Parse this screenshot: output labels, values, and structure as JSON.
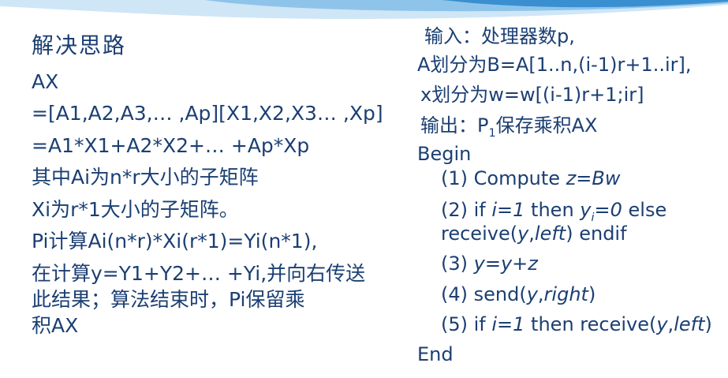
{
  "slide": {
    "left": {
      "title": "解决思路",
      "lines": [
        "AX",
        "=[A1,A2,A3,… ,Ap][X1,X2,X3… ,Xp]",
        "=A1*X1+A2*X2+… +Ap*Xp",
        "其中Ai为n*r大小的子矩阵",
        "Xi为r*1大小的子矩阵。",
        "Pi计算Ai(n*r)*Xi(r*1)=Yi(n*1),",
        "在计算y=Y1+Y2+… +Yi,并向右传送",
        "此结果；算法结束时，Pi保留乘",
        "积AX"
      ]
    },
    "right": {
      "input": "输入：处理器数p,",
      "partition_a": "A划分为B=A[1..n,(i-1)r+1..ir],",
      "partition_x": "x划分为w=w[(i-1)r+1;ir]",
      "output_prefix": "输出：P",
      "output_sub": "1",
      "output_suffix": "保存乘积AX",
      "begin": "Begin",
      "step1_prefix": "(1) Compute ",
      "step1_formula": "z=Bw",
      "step2_a": "(2) if ",
      "step2_b": "i=1",
      "step2_c": " then ",
      "step2_d": "y",
      "step2_e": "i",
      "step2_f": "=0",
      "step2_g": " else",
      "step2_line2_a": "receive(",
      "step2_line2_b": "y",
      "step2_line2_c": ",",
      "step2_line2_d": "left",
      "step2_line2_e": ") endif",
      "step3_prefix": "(3) ",
      "step3_formula": "y=y+z",
      "step4_a": "(4) send(",
      "step4_b": "y",
      "step4_c": ",",
      "step4_d": "right",
      "step4_e": ")",
      "step5_a": "(5) if ",
      "step5_b": "i=1",
      "step5_c": " then receive(",
      "step5_d": "y",
      "step5_e": ",",
      "step5_f": "left",
      "step5_g": ")",
      "end": "End"
    }
  },
  "colors": {
    "text": "#1b3f73",
    "wave_light": "#cfe6f7",
    "wave_mid": "#8fc4ea",
    "wave_dark": "#3a8fd0"
  }
}
